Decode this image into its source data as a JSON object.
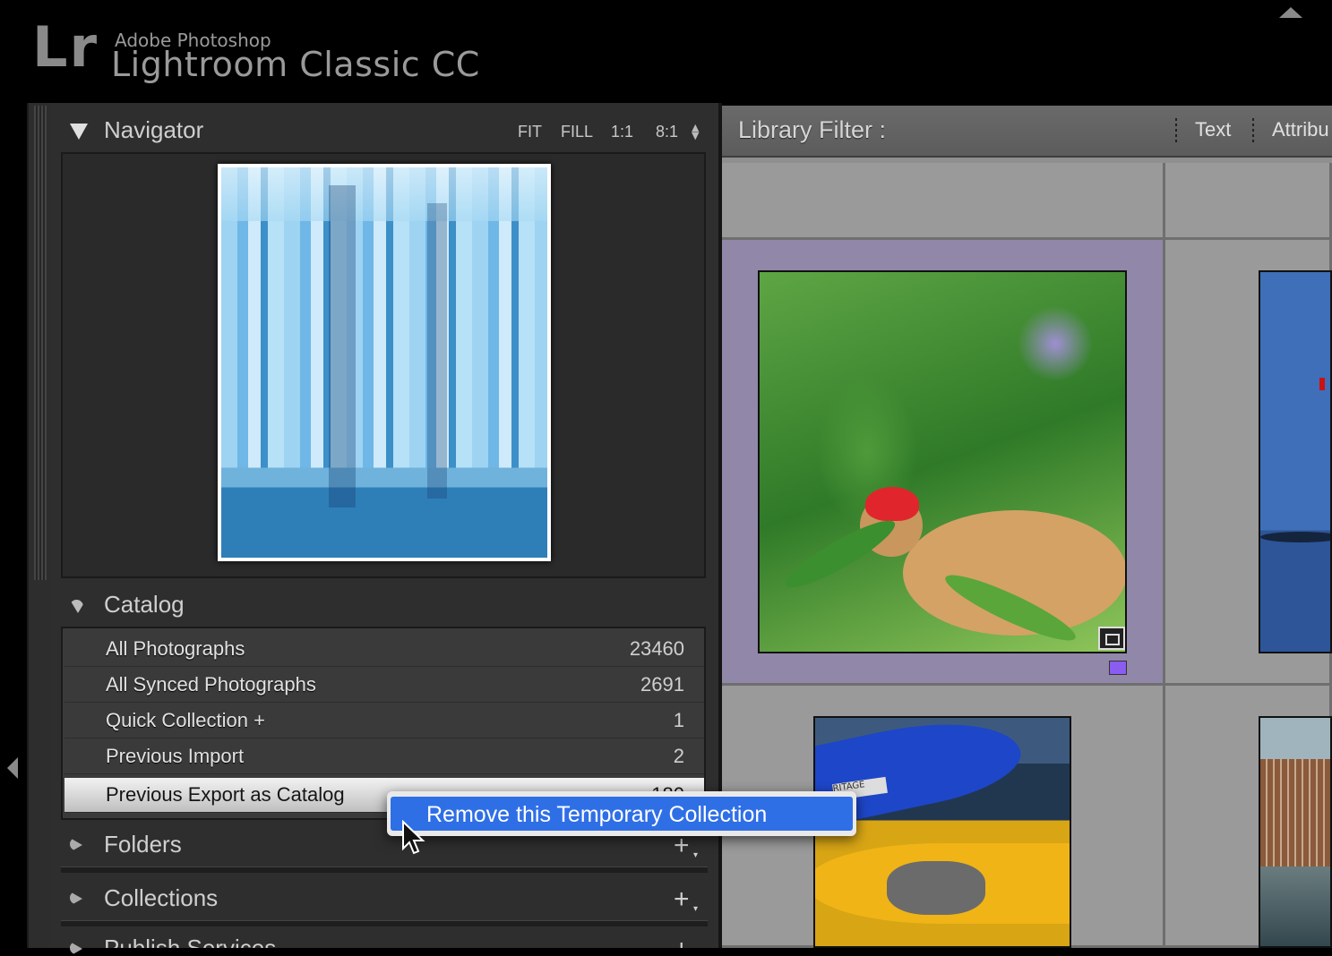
{
  "app": {
    "logo": "Lr",
    "brand_top": "Adobe Photoshop",
    "brand_name": "Lightroom Classic CC"
  },
  "navigator": {
    "title": "Navigator",
    "zoom_options": [
      "FIT",
      "FILL",
      "1:1",
      "8:1"
    ]
  },
  "catalog": {
    "title": "Catalog",
    "items": [
      {
        "label": "All Photographs",
        "count": "23460"
      },
      {
        "label": "All Synced Photographs",
        "count": "2691"
      },
      {
        "label": "Quick Collection +",
        "count": "1"
      },
      {
        "label": "Previous Import",
        "count": "2"
      },
      {
        "label": "Previous Export as Catalog",
        "count": "180",
        "selected": true
      }
    ]
  },
  "sections": {
    "folders": "Folders",
    "collections": "Collections",
    "publish": "Publish Services"
  },
  "library_filter": {
    "title": "Library Filter :",
    "options": [
      "Text",
      "Attribu"
    ]
  },
  "context_menu": {
    "item": "Remove this Temporary Collection"
  },
  "thumbnails": {
    "kayak_tag": "RITAGE"
  },
  "colors": {
    "selection_cell": "#9187a9",
    "menu_highlight": "#2f6fe6",
    "label_purple": "#8a5cf0"
  },
  "icons": [
    "lr-logo",
    "collapse-up-icon",
    "collapse-left-icon",
    "disclosure-triangle-icon",
    "add-plus-icon",
    "stack-badge-icon",
    "mouse-pointer-icon"
  ]
}
